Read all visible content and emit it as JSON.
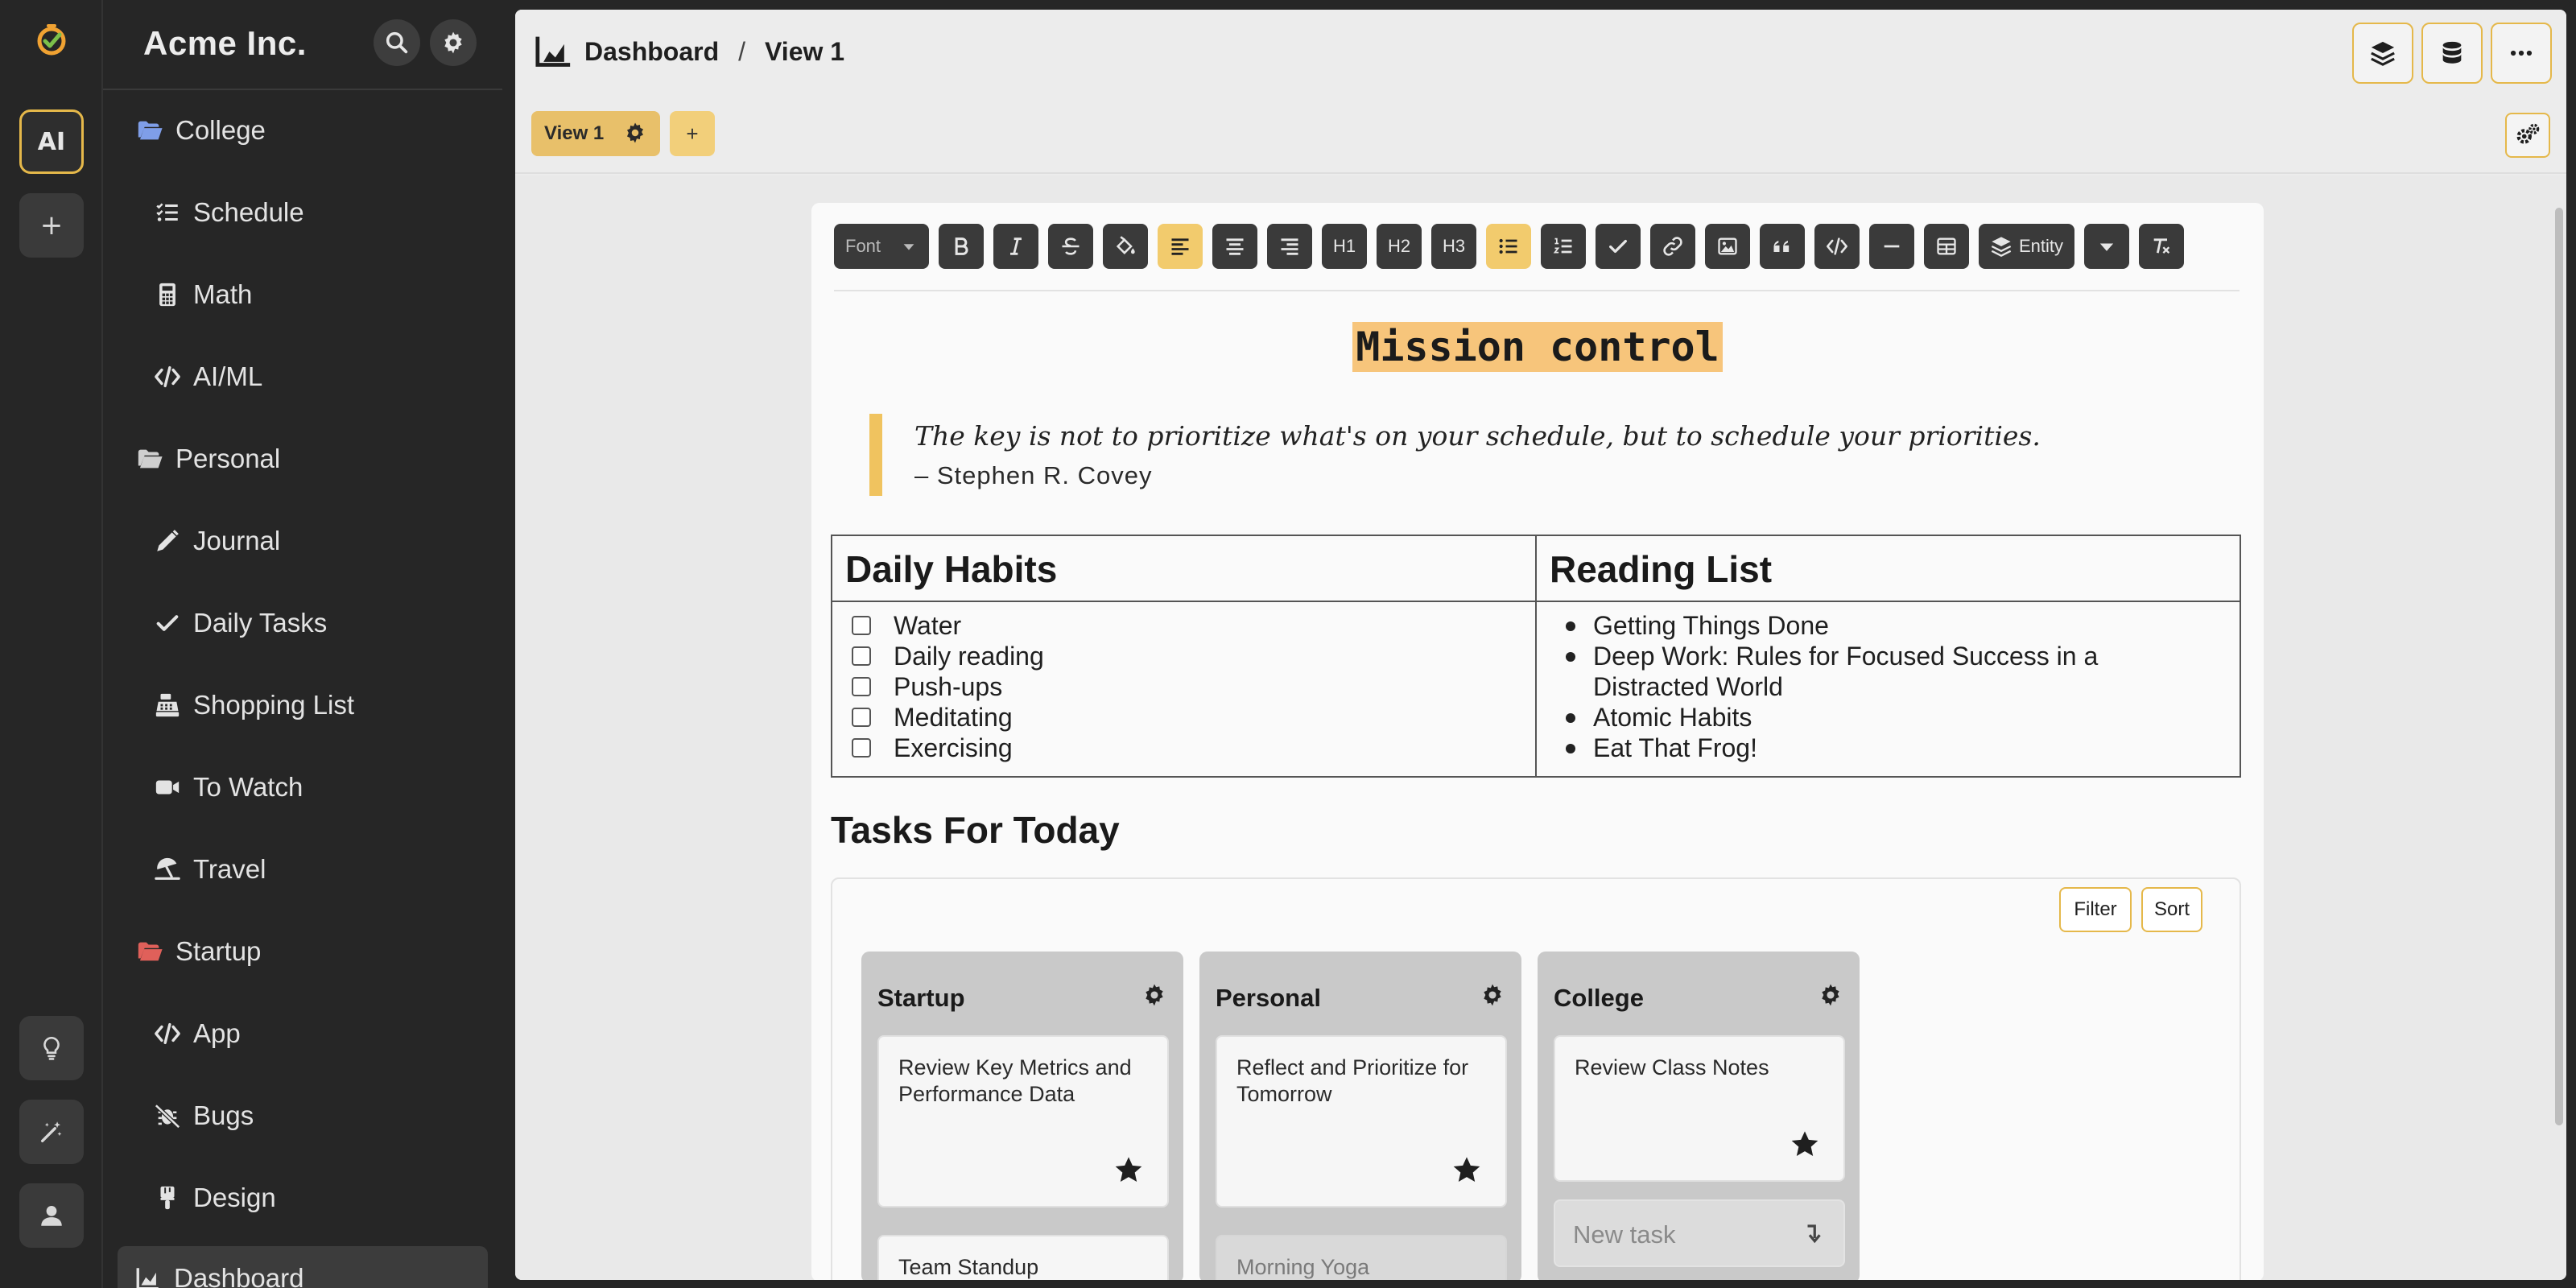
{
  "colors": {
    "accent": "#e5b84a",
    "highlight": "#f7c57b",
    "sidebar_bg": "#262626",
    "folder_blue": "#7f9ee8",
    "folder_red": "#e0605a"
  },
  "rail": {
    "ai_label": "AI",
    "add_label": "+"
  },
  "sidebar": {
    "title": "Acme Inc.",
    "items": [
      {
        "label": "College",
        "icon": "folder-open-icon"
      },
      {
        "label": "Schedule",
        "icon": "list-check-icon"
      },
      {
        "label": "Math",
        "icon": "calculator-icon"
      },
      {
        "label": "AI/ML",
        "icon": "code-icon"
      },
      {
        "label": "Personal",
        "icon": "folder-open-icon"
      },
      {
        "label": "Journal",
        "icon": "pencil-icon"
      },
      {
        "label": "Daily Tasks",
        "icon": "check-icon"
      },
      {
        "label": "Shopping List",
        "icon": "cash-register-icon"
      },
      {
        "label": "To Watch",
        "icon": "video-icon"
      },
      {
        "label": "Travel",
        "icon": "umbrella-beach-icon"
      },
      {
        "label": "Startup",
        "icon": "folder-open-icon"
      },
      {
        "label": "App",
        "icon": "code-icon"
      },
      {
        "label": "Bugs",
        "icon": "bug-slash-icon"
      },
      {
        "label": "Design",
        "icon": "paintbrush-icon"
      },
      {
        "label": "Dashboard",
        "icon": "chart-area-icon"
      }
    ]
  },
  "header": {
    "crumb_root": "Dashboard",
    "crumb_sep": "/",
    "crumb_view": "View 1"
  },
  "views": {
    "active_tab": "View 1",
    "add_label": "+"
  },
  "toolbar": {
    "font_label": "Font",
    "h1": "H1",
    "h2": "H2",
    "h3": "H3",
    "entity_label": "Entity"
  },
  "document": {
    "title": "Mission control",
    "quote": "The key is not to prioritize what's on your schedule, but to schedule your priorities.",
    "quote_author": "– Stephen R. Covey",
    "table": {
      "headers": [
        "Daily Habits",
        "Reading List"
      ],
      "habits": [
        "Water",
        "Daily reading",
        "Push-ups",
        "Meditating",
        "Exercising"
      ],
      "reading": [
        "Getting Things Done",
        "Deep Work: Rules for Focused Success in a Distracted World",
        "Atomic Habits",
        "Eat That Frog!"
      ]
    },
    "tasks_heading": "Tasks For Today"
  },
  "board": {
    "filter_label": "Filter",
    "sort_label": "Sort",
    "columns": [
      {
        "title": "Startup",
        "cards": [
          "Review Key Metrics and Performance Data",
          "Team Standup"
        ]
      },
      {
        "title": "Personal",
        "cards": [
          "Reflect and Prioritize for Tomorrow",
          "Morning Yoga"
        ]
      },
      {
        "title": "College",
        "cards": [
          "Review Class Notes"
        ],
        "new_task_placeholder": "New task"
      }
    ]
  }
}
